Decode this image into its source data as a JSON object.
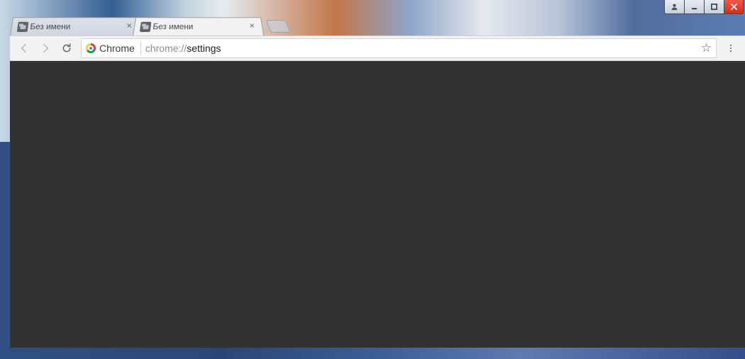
{
  "tabs": [
    {
      "title": "Без имени",
      "active": false
    },
    {
      "title": "Без имени",
      "active": true
    }
  ],
  "address": {
    "chip_label": "Chrome",
    "scheme": "chrome://",
    "path": "settings"
  }
}
